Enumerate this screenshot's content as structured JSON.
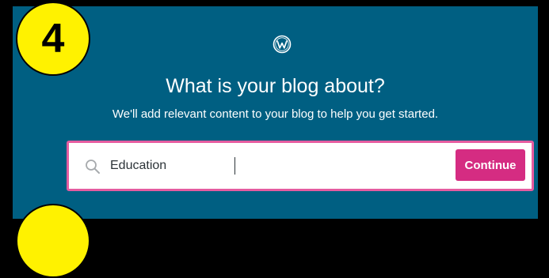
{
  "step": {
    "number": "4"
  },
  "header": {
    "logo_icon": "wordpress-logo-icon",
    "title": "What is your blog about?",
    "subtitle": "We'll add relevant content to your blog to help you get started."
  },
  "search": {
    "icon": "search-icon",
    "value": "Education",
    "continue_label": "Continue"
  },
  "colors": {
    "panel_bg": "#005f82",
    "badge": "#fff200",
    "accent": "#d52c82",
    "input_border": "#e55ca0"
  }
}
